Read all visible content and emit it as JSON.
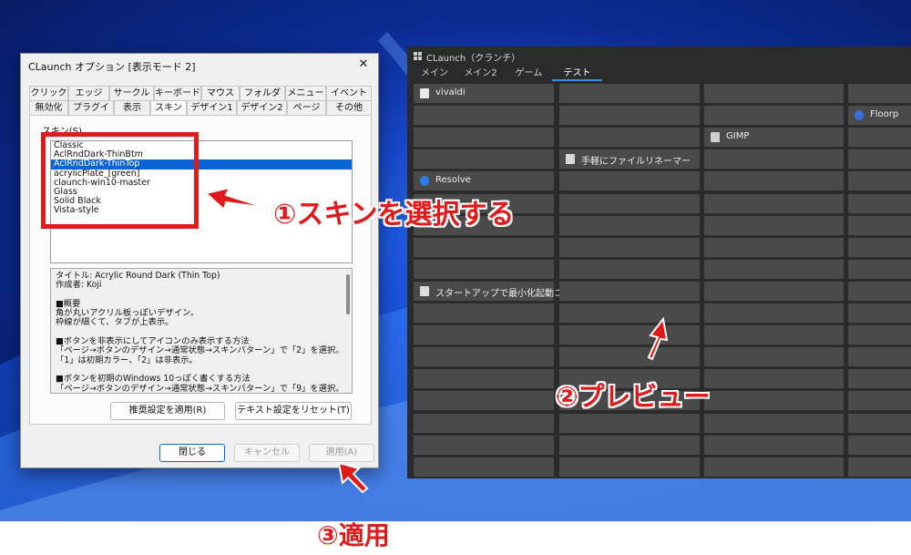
{
  "dialog": {
    "title": "CLaunch オプション [表示モード 2]",
    "close_glyph": "✕",
    "tabs_row1": [
      "クリック",
      "エッジ",
      "サークル",
      "キーボード",
      "マウス",
      "フォルダー",
      "メニュー",
      "イベント"
    ],
    "tabs_row2": [
      "無効化",
      "プラグイン",
      "表示",
      "スキン",
      "デザイン1",
      "デザイン2",
      "ページ",
      "その他"
    ],
    "active_tab": "スキン",
    "skin_label": "スキン(S)",
    "skins": [
      "Classic",
      "AclRndDark-ThinBtm",
      "AclRndDark-ThinTop",
      "acrylicPlate_[green]",
      "claunch-win10-master",
      "Glass",
      "Solid Black",
      "Vista-style"
    ],
    "selected_skin": "AclRndDark-ThinTop",
    "description": [
      "タイトル: Acrylic Round Dark (Thin Top)",
      "作成者: Koji",
      "",
      "■概要",
      "角が丸いアクリル板っぽいデザイン。",
      "枠線が細くて、タブが上表示。",
      "",
      "■ボタンを非表示にしてアイコンのみ表示する方法",
      "「ページ→ボタンのデザイン→通常状態→スキンパターン」で「2」を選択。",
      "「1」は初期カラー、「2」は非表示。",
      "",
      "■ボタンを初期のWindows 10っぽく書くする方法",
      "「ページ→ボタンのデザイン→通常状態→スキンパターン」で「9」を選択。"
    ],
    "apply_recommended_button": "推奨設定を適用(R)",
    "reset_text_button": "テキスト設定をリセット(T)",
    "close_button": "閉じる",
    "cancel_button": "キャンセル",
    "apply_button": "適用(A)"
  },
  "preview": {
    "title": "CLaunch（クランチ）",
    "tabs": [
      "メイン",
      "メイン2",
      "ゲーム",
      "テスト"
    ],
    "active_tab": "テスト",
    "items": {
      "vivaldi": "vivaldi",
      "floorp": "Floorp",
      "gimp": "GIMP",
      "renamer": "手軽にファイルリネーマー",
      "resolve": "Resolve",
      "startup": "スタートアップで最小化起動コ"
    }
  },
  "annotations": {
    "step1": "①スキンを選択する",
    "step2": "②プレビュー",
    "step3": "③適用",
    "color": "#e01a1a"
  },
  "colors": {
    "selection": "#0a64d6",
    "preview_bg": "#2b2b2b",
    "preview_cell": "#4a4a4a",
    "accent_tab": "#3a8ee6"
  }
}
